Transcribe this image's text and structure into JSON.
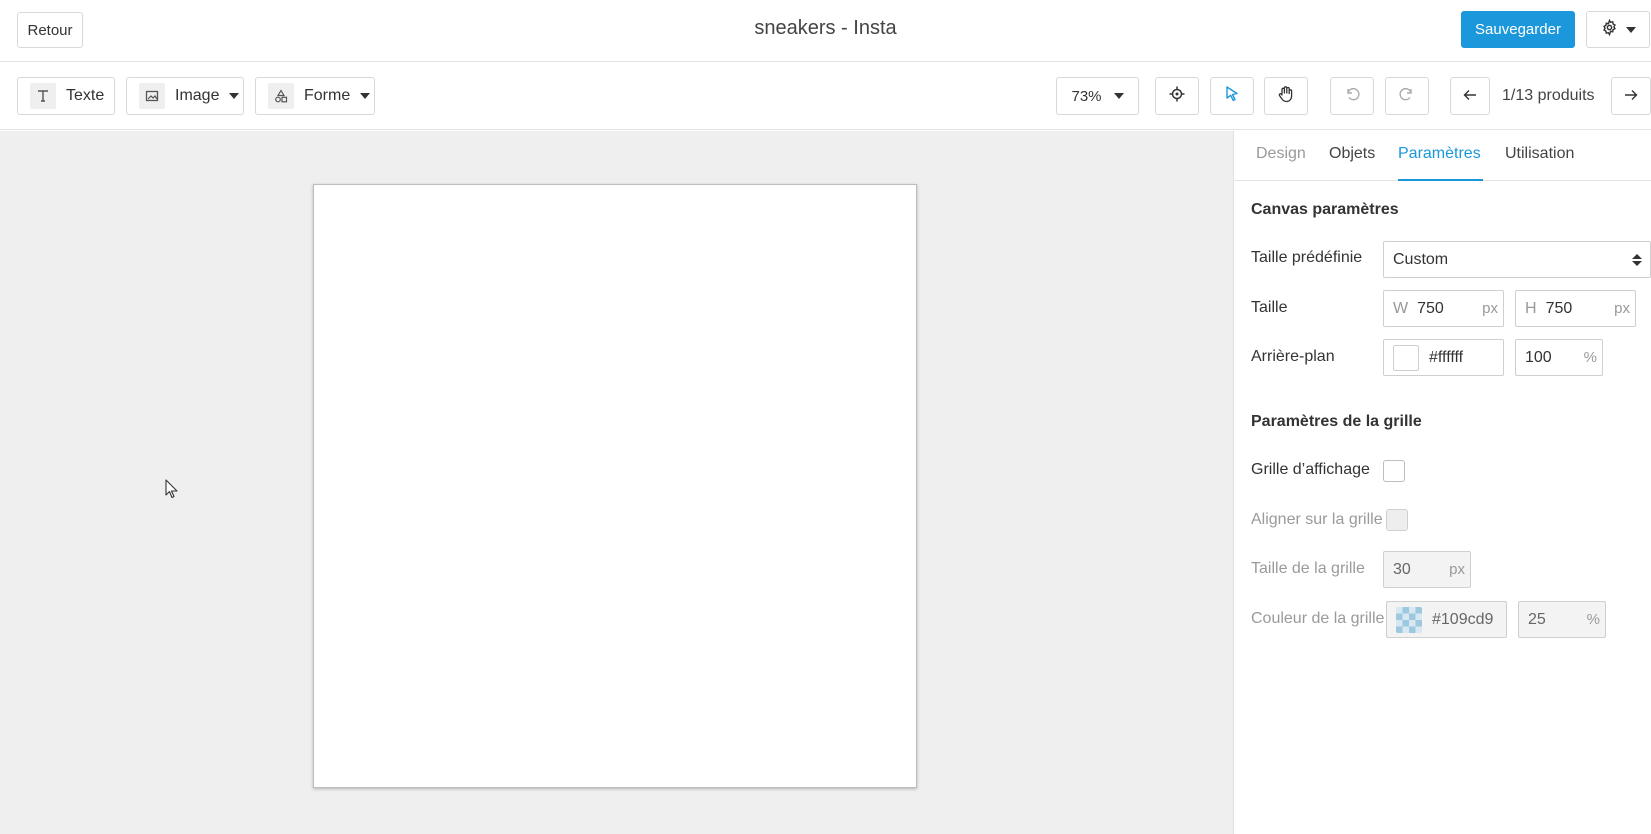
{
  "header": {
    "back_label": "Retour",
    "title": "sneakers - Insta",
    "save_label": "Sauvegarder"
  },
  "toolbar": {
    "text_label": "Texte",
    "image_label": "Image",
    "shape_label": "Forme",
    "zoom": "73%",
    "pagination": "1/13 produits",
    "icons": [
      "text-icon",
      "image-icon",
      "shapes-icon",
      "target-icon",
      "pointer-icon",
      "hand-icon",
      "undo-icon",
      "redo-icon",
      "arrow-left-icon",
      "arrow-right-icon",
      "gear-icon"
    ],
    "active_tool": "pointer",
    "accent": "#1b97db"
  },
  "panel": {
    "tabs": [
      {
        "label": "Design"
      },
      {
        "label": "Objets"
      },
      {
        "label": "Paramètres"
      },
      {
        "label": "Utilisation"
      }
    ],
    "active_tab": "Paramètres",
    "canvas": {
      "title": "Canvas paramètres",
      "preset_label": "Taille prédéfinie",
      "preset_value": "Custom",
      "size_label": "Taille",
      "width_prefix": "W",
      "width": "750",
      "height_prefix": "H",
      "height": "750",
      "unit": "px",
      "background_label": "Arrière-plan",
      "background_color": "#ffffff",
      "background_opacity": "100",
      "percent_symbol": "%"
    },
    "grid": {
      "title": "Paramètres de la grille",
      "show_label": "Grille d’affichage",
      "show_checked": false,
      "snap_label": "Aligner sur la grille",
      "snap_checked": false,
      "size_label": "Taille de la grille",
      "size": "30",
      "unit": "px",
      "color_label": "Couleur de la grille",
      "color": "#109cd9",
      "opacity": "25",
      "percent_symbol": "%"
    }
  }
}
